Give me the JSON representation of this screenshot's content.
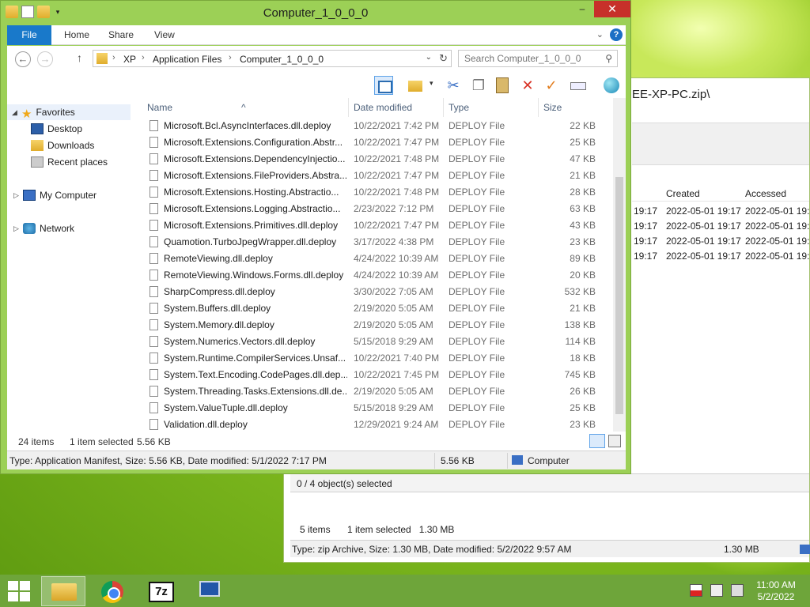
{
  "window": {
    "title": "Computer_1_0_0_0",
    "controls": {
      "minimize": "–",
      "maximize": "□",
      "close": "✕"
    }
  },
  "ribbon": {
    "tabs": [
      "File",
      "Home",
      "Share",
      "View"
    ],
    "help": "?"
  },
  "address": {
    "crumbs": [
      "XP",
      "Application Files",
      "Computer_1_0_0_0"
    ],
    "search_placeholder": "Search Computer_1_0_0_0"
  },
  "nav_pane": {
    "favorites": "Favorites",
    "fav_items": [
      "Desktop",
      "Downloads",
      "Recent places"
    ],
    "my_computer": "My Computer",
    "network": "Network"
  },
  "columns": {
    "name": "Name",
    "date": "Date modified",
    "type": "Type",
    "size": "Size"
  },
  "files": [
    {
      "name": "Microsoft.Bcl.AsyncInterfaces.dll.deploy",
      "date": "10/22/2021 7:42 PM",
      "type": "DEPLOY File",
      "size": "22 KB"
    },
    {
      "name": "Microsoft.Extensions.Configuration.Abstr...",
      "date": "10/22/2021 7:47 PM",
      "type": "DEPLOY File",
      "size": "25 KB"
    },
    {
      "name": "Microsoft.Extensions.DependencyInjectio...",
      "date": "10/22/2021 7:48 PM",
      "type": "DEPLOY File",
      "size": "47 KB"
    },
    {
      "name": "Microsoft.Extensions.FileProviders.Abstra...",
      "date": "10/22/2021 7:47 PM",
      "type": "DEPLOY File",
      "size": "21 KB"
    },
    {
      "name": "Microsoft.Extensions.Hosting.Abstractio...",
      "date": "10/22/2021 7:48 PM",
      "type": "DEPLOY File",
      "size": "28 KB"
    },
    {
      "name": "Microsoft.Extensions.Logging.Abstractio...",
      "date": "2/23/2022 7:12 PM",
      "type": "DEPLOY File",
      "size": "63 KB"
    },
    {
      "name": "Microsoft.Extensions.Primitives.dll.deploy",
      "date": "10/22/2021 7:47 PM",
      "type": "DEPLOY File",
      "size": "43 KB"
    },
    {
      "name": "Quamotion.TurboJpegWrapper.dll.deploy",
      "date": "3/17/2022 4:38 PM",
      "type": "DEPLOY File",
      "size": "23 KB"
    },
    {
      "name": "RemoteViewing.dll.deploy",
      "date": "4/24/2022 10:39 AM",
      "type": "DEPLOY File",
      "size": "89 KB"
    },
    {
      "name": "RemoteViewing.Windows.Forms.dll.deploy",
      "date": "4/24/2022 10:39 AM",
      "type": "DEPLOY File",
      "size": "20 KB"
    },
    {
      "name": "SharpCompress.dll.deploy",
      "date": "3/30/2022 7:05 AM",
      "type": "DEPLOY File",
      "size": "532 KB"
    },
    {
      "name": "System.Buffers.dll.deploy",
      "date": "2/19/2020 5:05 AM",
      "type": "DEPLOY File",
      "size": "21 KB"
    },
    {
      "name": "System.Memory.dll.deploy",
      "date": "2/19/2020 5:05 AM",
      "type": "DEPLOY File",
      "size": "138 KB"
    },
    {
      "name": "System.Numerics.Vectors.dll.deploy",
      "date": "5/15/2018 9:29 AM",
      "type": "DEPLOY File",
      "size": "114 KB"
    },
    {
      "name": "System.Runtime.CompilerServices.Unsaf...",
      "date": "10/22/2021 7:40 PM",
      "type": "DEPLOY File",
      "size": "18 KB"
    },
    {
      "name": "System.Text.Encoding.CodePages.dll.dep...",
      "date": "10/22/2021 7:45 PM",
      "type": "DEPLOY File",
      "size": "745 KB"
    },
    {
      "name": "System.Threading.Tasks.Extensions.dll.de...",
      "date": "2/19/2020 5:05 AM",
      "type": "DEPLOY File",
      "size": "26 KB"
    },
    {
      "name": "System.ValueTuple.dll.deploy",
      "date": "5/15/2018 9:29 AM",
      "type": "DEPLOY File",
      "size": "25 KB"
    },
    {
      "name": "Validation.dll.deploy",
      "date": "12/29/2021 9:24 AM",
      "type": "DEPLOY File",
      "size": "23 KB"
    }
  ],
  "list_footer": {
    "items": "24 items",
    "selected": "1 item selected",
    "size": "5.56 KB"
  },
  "statusbar": {
    "info": "Type: Application Manifest, Size: 5.56 KB, Date modified: 5/1/2022 7:17 PM",
    "size": "5.56 KB",
    "location": "Computer"
  },
  "back_window": {
    "title": "EE-XP-PC.zip\\",
    "col_created": "Created",
    "col_accessed": "Accessed",
    "rows": [
      {
        "modified": "19:17",
        "created": "2022-05-01 19:17",
        "accessed": "2022-05-01 19:1"
      },
      {
        "modified": "19:17",
        "created": "2022-05-01 19:17",
        "accessed": "2022-05-01 19:1"
      },
      {
        "modified": "19:17",
        "created": "2022-05-01 19:17",
        "accessed": "2022-05-01 19:1"
      },
      {
        "modified": "19:17",
        "created": "2022-05-01 19:17",
        "accessed": "2022-05-01 19:1"
      }
    ],
    "selection": "0 / 4 object(s) selected",
    "items": "5 items",
    "item_selected": "1 item selected",
    "item_size": "1.30 MB",
    "status_info": "Type: zip Archive, Size: 1.30 MB, Date modified: 5/2/2022 9:57 AM",
    "status_size": "1.30 MB"
  },
  "taskbar": {
    "apps": [
      "file-explorer",
      "chrome",
      "7-zip",
      "remote-desktop"
    ],
    "sevenzip_label": "7z",
    "time": "11:00 AM",
    "date": "5/2/2022"
  }
}
